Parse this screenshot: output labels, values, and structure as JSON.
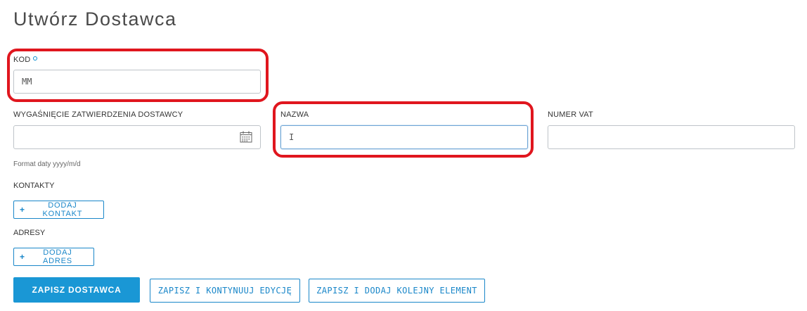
{
  "page": {
    "title": "Utwórz Dostawca"
  },
  "form": {
    "kod": {
      "label": "KOD",
      "value": "MM"
    },
    "approval_expiry": {
      "label": "WYGAŚNIĘCIE ZATWIERDZENIA DOSTAWCY",
      "value": "",
      "hint": "Format daty yyyy/m/d"
    },
    "nazwa": {
      "label": "NAZWA",
      "value": "I"
    },
    "vat": {
      "label": "NUMER VAT",
      "value": ""
    }
  },
  "contacts": {
    "label": "KONTAKTY",
    "add_button": "DODAJ KONTAKT"
  },
  "addresses": {
    "label": "ADRESY",
    "add_button": "DODAJ ADRES"
  },
  "actions": {
    "save": "ZAPISZ DOSTAWCA",
    "save_continue": "ZAPISZ I KONTYNUUJ EDYCJĘ",
    "save_add_another": "ZAPISZ I DODAJ KOLEJNY ELEMENT"
  },
  "colors": {
    "accent": "#1a97d5",
    "highlight": "#e0161e"
  }
}
